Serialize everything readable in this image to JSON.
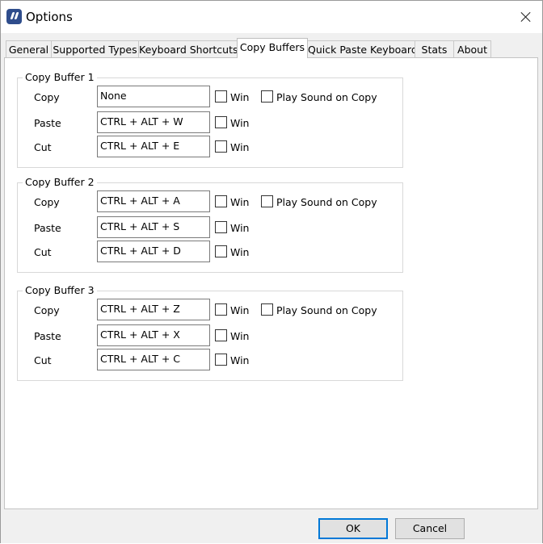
{
  "window": {
    "title": "Options",
    "icon": "app-quote-icon",
    "close_icon": "close-icon"
  },
  "tabs": [
    {
      "label": "General"
    },
    {
      "label": "Supported Types"
    },
    {
      "label": "Keyboard Shortcuts"
    },
    {
      "label": "Copy Buffers",
      "active": true
    },
    {
      "label": "Quick Paste Keyboard"
    },
    {
      "label": "Stats"
    },
    {
      "label": "About"
    }
  ],
  "buffers": [
    {
      "title": "Copy Buffer 1",
      "rows": [
        {
          "label": "Copy",
          "hotkey": "None",
          "win_label": "Win",
          "win_checked": false
        },
        {
          "label": "Paste",
          "hotkey": "CTRL + ALT + W",
          "win_label": "Win",
          "win_checked": false
        },
        {
          "label": "Cut",
          "hotkey": "CTRL + ALT + E",
          "win_label": "Win",
          "win_checked": false
        }
      ],
      "play_sound_label": "Play Sound on Copy",
      "play_sound_checked": false
    },
    {
      "title": "Copy Buffer 2",
      "rows": [
        {
          "label": "Copy",
          "hotkey": "CTRL + ALT + A",
          "win_label": "Win",
          "win_checked": false
        },
        {
          "label": "Paste",
          "hotkey": "CTRL + ALT + S",
          "win_label": "Win",
          "win_checked": false
        },
        {
          "label": "Cut",
          "hotkey": "CTRL + ALT + D",
          "win_label": "Win",
          "win_checked": false
        }
      ],
      "play_sound_label": "Play Sound on Copy",
      "play_sound_checked": false
    },
    {
      "title": "Copy Buffer 3",
      "rows": [
        {
          "label": "Copy",
          "hotkey": "CTRL + ALT + Z",
          "win_label": "Win",
          "win_checked": false
        },
        {
          "label": "Paste",
          "hotkey": "CTRL + ALT + X",
          "win_label": "Win",
          "win_checked": false
        },
        {
          "label": "Cut",
          "hotkey": "CTRL + ALT + C",
          "win_label": "Win",
          "win_checked": false
        }
      ],
      "play_sound_label": "Play Sound on Copy",
      "play_sound_checked": false
    }
  ],
  "footer": {
    "ok_label": "OK",
    "cancel_label": "Cancel"
  },
  "colors": {
    "accent": "#0078d7",
    "dialog_bg": "#f0f0f0",
    "panel_bg": "#ffffff",
    "app_icon": "#2f4d8c"
  }
}
